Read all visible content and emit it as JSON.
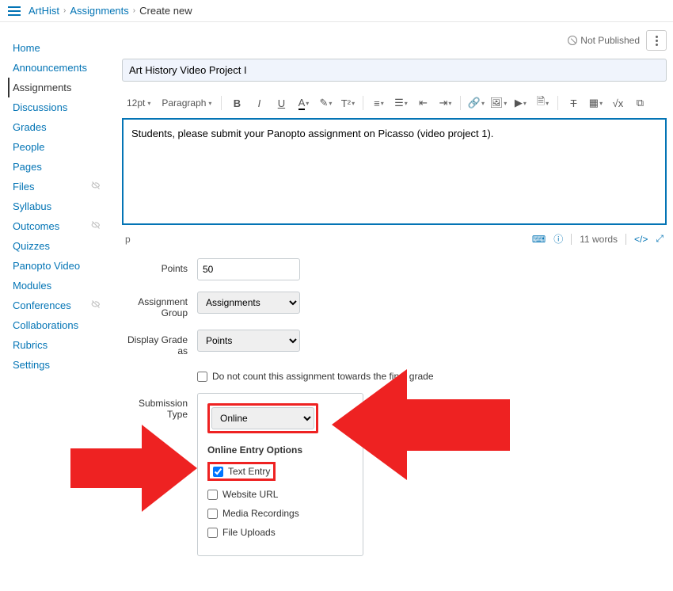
{
  "breadcrumb": {
    "course": "ArtHist",
    "section": "Assignments",
    "current": "Create new"
  },
  "status": {
    "not_published": "Not Published"
  },
  "sidebar": {
    "items": [
      {
        "label": "Home",
        "hidden": false
      },
      {
        "label": "Announcements",
        "hidden": false
      },
      {
        "label": "Assignments",
        "hidden": false,
        "active": true
      },
      {
        "label": "Discussions",
        "hidden": false
      },
      {
        "label": "Grades",
        "hidden": false
      },
      {
        "label": "People",
        "hidden": false
      },
      {
        "label": "Pages",
        "hidden": false
      },
      {
        "label": "Files",
        "hidden": true
      },
      {
        "label": "Syllabus",
        "hidden": false
      },
      {
        "label": "Outcomes",
        "hidden": true
      },
      {
        "label": "Quizzes",
        "hidden": false
      },
      {
        "label": "Panopto Video",
        "hidden": false
      },
      {
        "label": "Modules",
        "hidden": false
      },
      {
        "label": "Conferences",
        "hidden": true
      },
      {
        "label": "Collaborations",
        "hidden": false
      },
      {
        "label": "Rubrics",
        "hidden": false
      },
      {
        "label": "Settings",
        "hidden": false
      }
    ]
  },
  "assignment": {
    "title": "Art History Video Project I",
    "body": "Students, please submit your Panopto assignment on Picasso (video project 1).",
    "path_tag": "p",
    "word_count": "11 words"
  },
  "toolbar": {
    "font_size": "12pt",
    "block": "Paragraph"
  },
  "form": {
    "points_label": "Points",
    "points_value": "50",
    "group_label": "Assignment Group",
    "group_value": "Assignments",
    "display_label": "Display Grade as",
    "display_value": "Points",
    "omit_label": "Do not count this assignment towards the final grade",
    "submission_label": "Submission Type",
    "submission_value": "Online",
    "entry_heading": "Online Entry Options",
    "opts": {
      "text_entry": "Text Entry",
      "website_url": "Website URL",
      "media": "Media Recordings",
      "file": "File Uploads"
    }
  }
}
